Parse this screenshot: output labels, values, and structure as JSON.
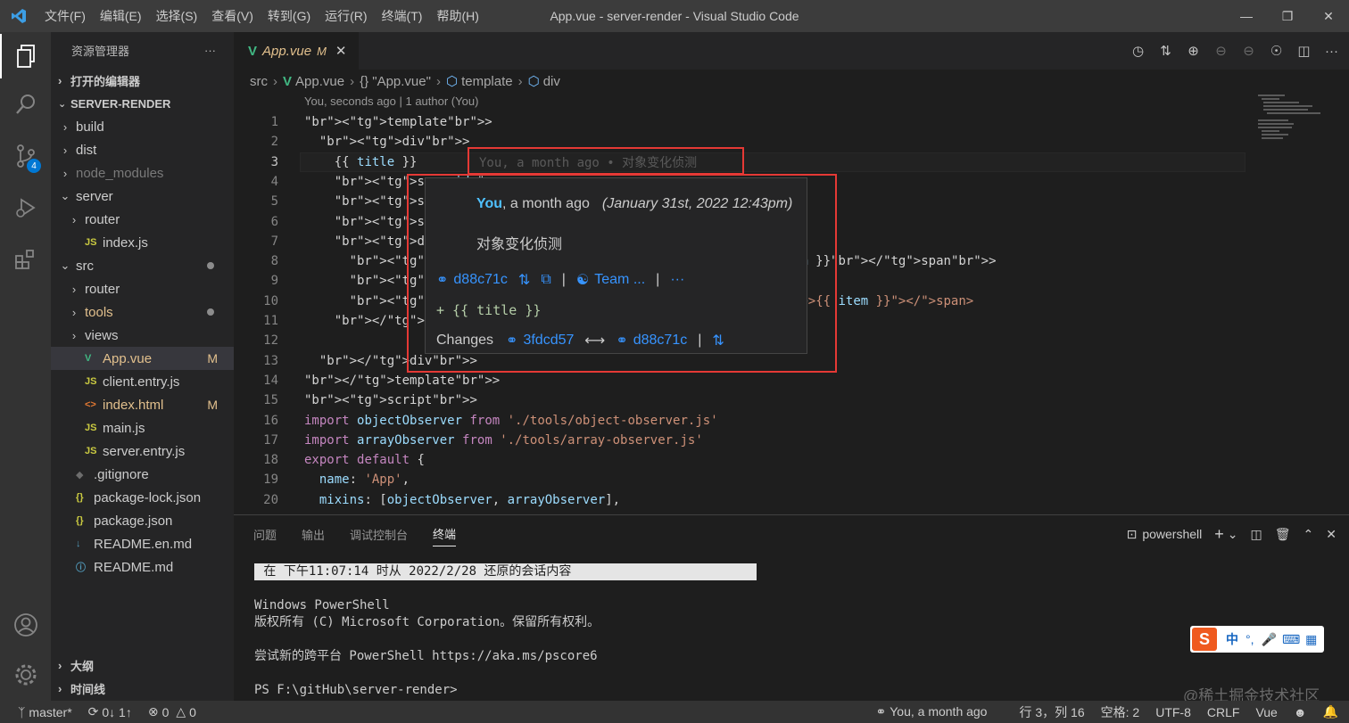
{
  "window": {
    "title": "App.vue - server-render - Visual Studio Code"
  },
  "menu": [
    "文件(F)",
    "编辑(E)",
    "选择(S)",
    "查看(V)",
    "转到(G)",
    "运行(R)",
    "终端(T)",
    "帮助(H)"
  ],
  "activity": {
    "scm_badge": "4"
  },
  "sidebar": {
    "title": "资源管理器",
    "more": "···",
    "open_editors": "打开的编辑器",
    "project": "SERVER-RENDER",
    "items": [
      {
        "label": "build",
        "kind": "folder",
        "open": false,
        "depth": 1
      },
      {
        "label": "dist",
        "kind": "folder",
        "open": false,
        "depth": 1
      },
      {
        "label": "node_modules",
        "kind": "folder",
        "open": false,
        "depth": 1,
        "dim": true
      },
      {
        "label": "server",
        "kind": "folder",
        "open": true,
        "depth": 1
      },
      {
        "label": "router",
        "kind": "folder",
        "open": false,
        "depth": 2
      },
      {
        "label": "index.js",
        "kind": "js",
        "depth": 2
      },
      {
        "label": "src",
        "kind": "folder",
        "open": true,
        "depth": 1,
        "dot": true
      },
      {
        "label": "router",
        "kind": "folder",
        "open": false,
        "depth": 2
      },
      {
        "label": "tools",
        "kind": "folder",
        "open": false,
        "depth": 2,
        "dot": true,
        "color": "#e2c08d"
      },
      {
        "label": "views",
        "kind": "folder",
        "open": false,
        "depth": 2
      },
      {
        "label": "App.vue",
        "kind": "vue",
        "depth": 2,
        "status": "M",
        "selected": true,
        "color": "#e2c08d"
      },
      {
        "label": "client.entry.js",
        "kind": "js",
        "depth": 2
      },
      {
        "label": "index.html",
        "kind": "html",
        "depth": 2,
        "status": "M",
        "color": "#e2c08d"
      },
      {
        "label": "main.js",
        "kind": "js",
        "depth": 2
      },
      {
        "label": "server.entry.js",
        "kind": "js",
        "depth": 2
      },
      {
        "label": ".gitignore",
        "kind": "git",
        "depth": 1
      },
      {
        "label": "package-lock.json",
        "kind": "json",
        "depth": 1
      },
      {
        "label": "package.json",
        "kind": "json",
        "depth": 1
      },
      {
        "label": "README.en.md",
        "kind": "md",
        "depth": 1
      },
      {
        "label": "README.md",
        "kind": "info",
        "depth": 1
      }
    ],
    "outline": "大纲",
    "timeline": "时间线"
  },
  "editor": {
    "tab_label": "App.vue",
    "tab_status": "M",
    "breadcrumb": [
      "src",
      "App.vue",
      "{} \"App.vue\"",
      "template",
      "div"
    ],
    "codelens": "You, seconds ago | 1 author (You)",
    "inline_blame": "You, a month ago • 对象变化侦测",
    "lines": [
      {
        "n": "1",
        "t": "<template>"
      },
      {
        "n": "2",
        "t": "  <div>"
      },
      {
        "n": "3",
        "t": "    {{ title }}"
      },
      {
        "n": "4",
        "t": "    <span id=\"s"
      },
      {
        "n": "5",
        "t": "    <span id=\"s"
      },
      {
        "n": "6",
        "t": "    <span @clic"
      },
      {
        "n": "7",
        "t": "    <div>"
      },
      {
        "n": "8",
        "t": "      <span v-f                                      item }}</span>"
      },
      {
        "n": "9",
        "t": "      <span @cl"
      },
      {
        "n": "10",
        "t": "      <span v-f                                   ndex\">{{ item }}</span>"
      },
      {
        "n": "11",
        "t": "    </div>"
      },
      {
        "n": "12",
        "t": ""
      },
      {
        "n": "13",
        "t": "  </div>"
      },
      {
        "n": "14",
        "t": "</template>"
      },
      {
        "n": "15",
        "t": "<script>"
      },
      {
        "n": "16",
        "t": "import objectObserver from './tools/object-observer.js'"
      },
      {
        "n": "17",
        "t": "import arrayObserver from './tools/array-observer.js'"
      },
      {
        "n": "18",
        "t": "export default {"
      },
      {
        "n": "19",
        "t": "  name: 'App',"
      },
      {
        "n": "20",
        "t": "  mixins: [objectObserver, arrayObserver],"
      }
    ]
  },
  "hover": {
    "author": "You",
    "when": ", a month ago",
    "date": "(January 31st, 2022 12:43pm)",
    "message": "对象变化侦测",
    "commit": "d88c71c",
    "team": "Team ...",
    "more": "···",
    "diff": "+ {{ title }}",
    "changes_label": "Changes",
    "from": "3fdcd57",
    "arrow": "⟷",
    "to": "d88c71c"
  },
  "panel": {
    "tabs": [
      "问题",
      "输出",
      "调试控制台",
      "终端"
    ],
    "active_tab": "终端",
    "shell": "powershell",
    "terminal": {
      "restore": " 在 下午11:07:14 时从 2022/2/28 还原的会话内容",
      "l1": "Windows PowerShell",
      "l2": "版权所有 (C) Microsoft Corporation。保留所有权利。",
      "l3": "尝试新的跨平台 PowerShell https://aka.ms/pscore6",
      "l4": "PS F:\\gitHub\\server-render>"
    }
  },
  "ime": {
    "logo": "S",
    "label": "中",
    "punct": "°,"
  },
  "watermark": "@稀土掘金技术社区",
  "status": {
    "branch": "master*",
    "sync": "0↓ 1↑",
    "errors": "0",
    "warnings": "0",
    "blame": "You, a month ago",
    "position": "行 3，列 16",
    "spaces": "空格: 2",
    "encoding": "UTF-8",
    "eol": "CRLF",
    "language": "Vue"
  }
}
